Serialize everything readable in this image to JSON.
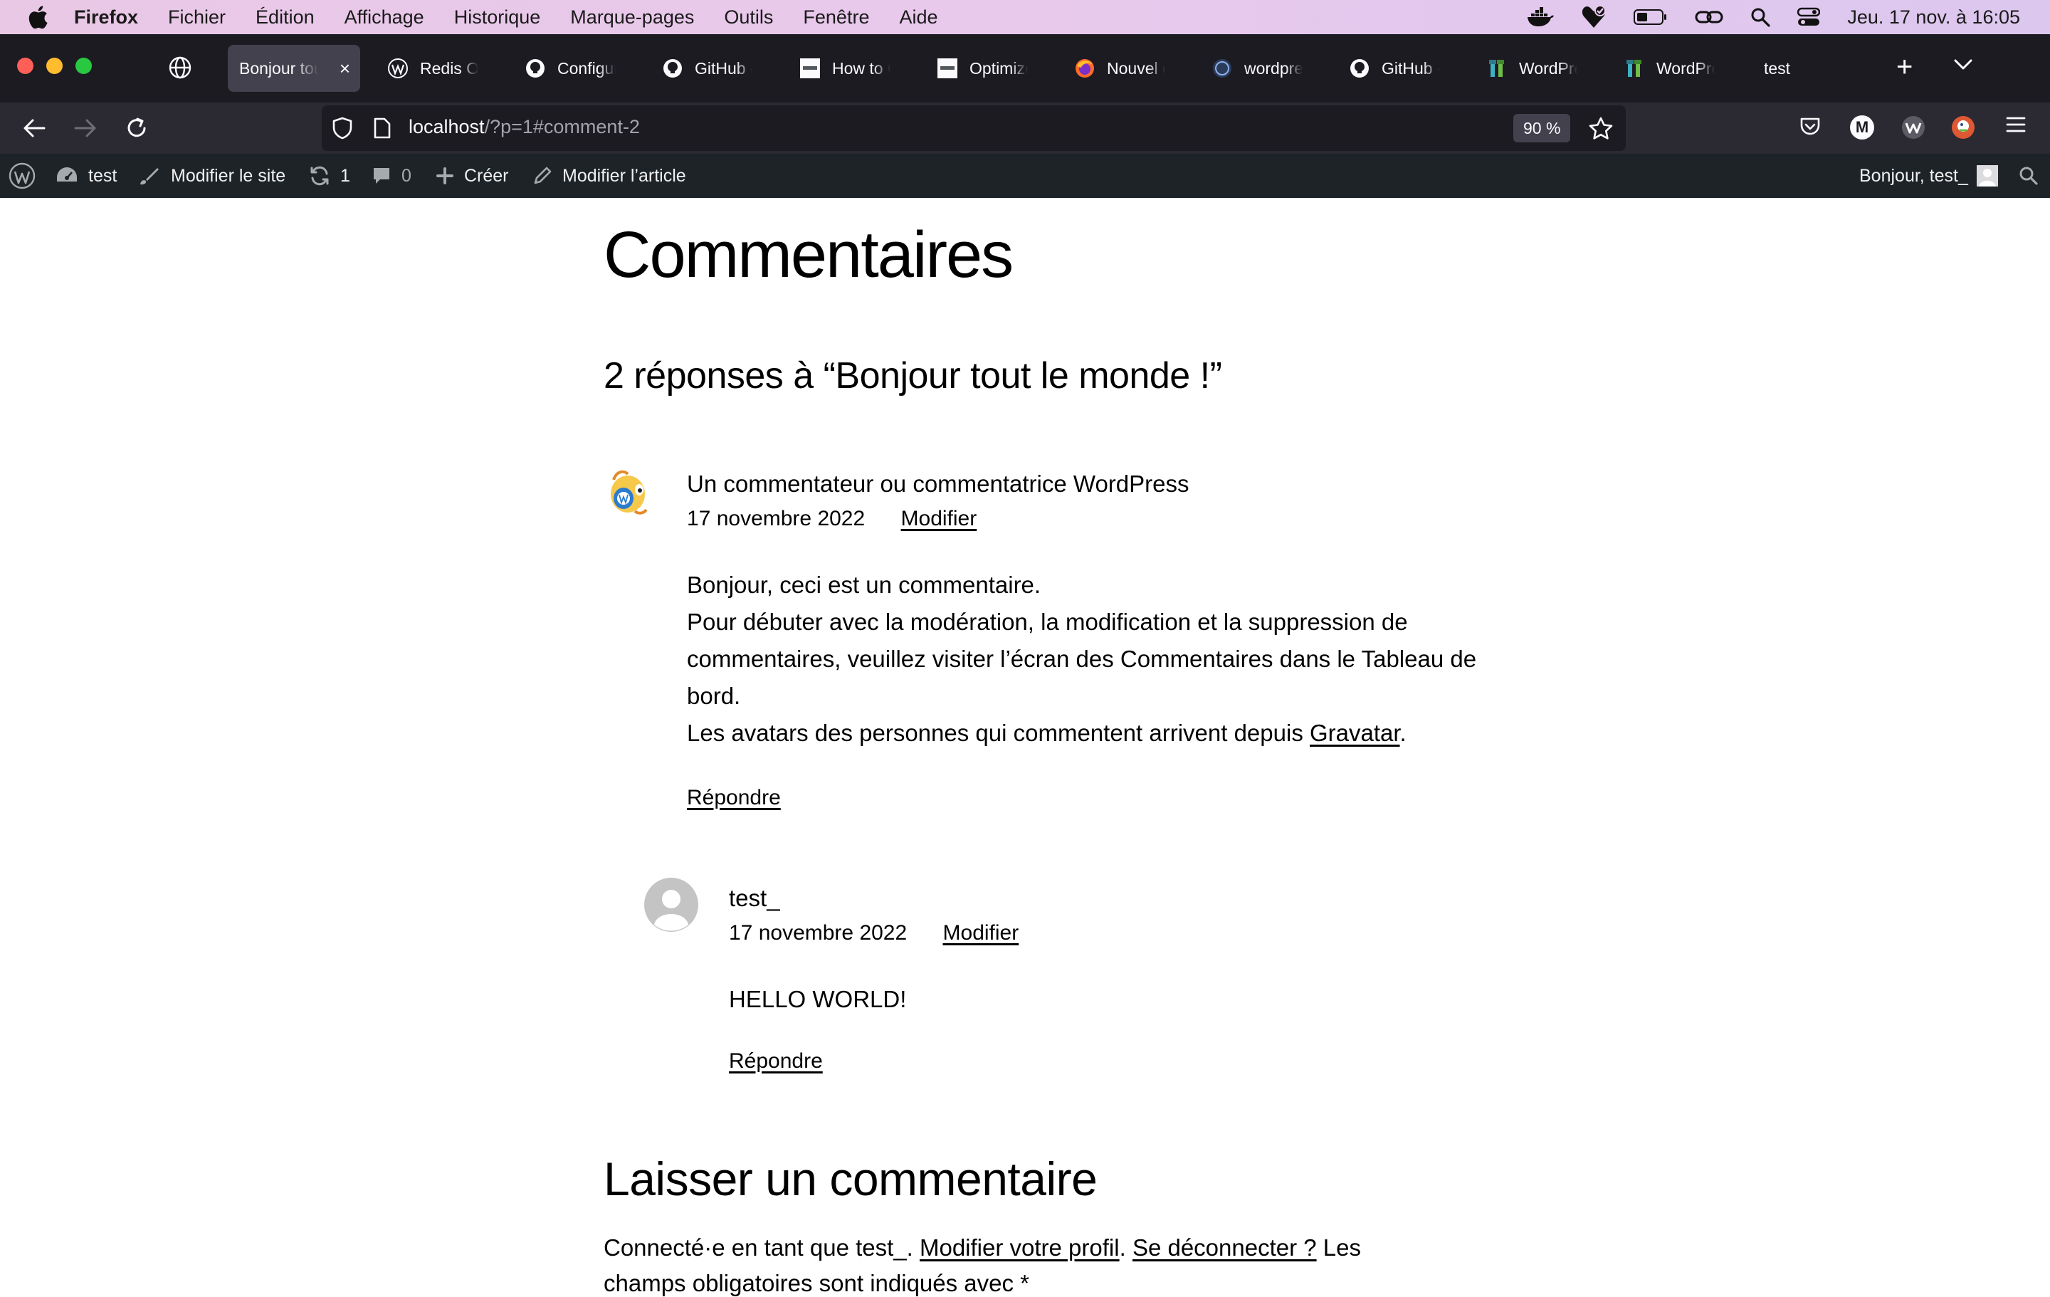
{
  "menubar": {
    "app": "Firefox",
    "items": [
      "Fichier",
      "Édition",
      "Affichage",
      "Historique",
      "Marque-pages",
      "Outils",
      "Fenêtre",
      "Aide"
    ],
    "clock": "Jeu. 17 nov. à  16:05"
  },
  "tabs": [
    {
      "label": "Bonjour tout",
      "icon": "globe-icon",
      "active": true
    },
    {
      "label": "Redis Obje",
      "icon": "wordpress-icon"
    },
    {
      "label": "Configurat",
      "icon": "github-icon"
    },
    {
      "label": "GitHub - p",
      "icon": "github-icon"
    },
    {
      "label": "How to Op",
      "icon": "plesk-icon"
    },
    {
      "label": "Optimize V",
      "icon": "plesk-icon"
    },
    {
      "label": "Nouvel ong",
      "icon": "firefox-icon"
    },
    {
      "label": "wordpress",
      "icon": "docker-icon"
    },
    {
      "label": "GitHub - d",
      "icon": "github-icon"
    },
    {
      "label": "WordPress",
      "icon": "wp-plugin-icon"
    },
    {
      "label": "WordPress",
      "icon": "wp-plugin-icon"
    },
    {
      "label": "test",
      "icon": "none"
    }
  ],
  "urlbar": {
    "host": "localhost",
    "path": "/?p=1#comment-2",
    "zoom": "90 %"
  },
  "adminbar": {
    "site": "test",
    "edit_site": "Modifier le site",
    "updates": "1",
    "comments": "0",
    "new": "Créer",
    "edit_post": "Modifier l’article",
    "greeting": "Bonjour, test_"
  },
  "page": {
    "title": "Commentaires",
    "responses_heading": "2 réponses à “Bonjour tout le monde !”",
    "comments": [
      {
        "author": "Un commentateur ou commentatrice WordPress",
        "date": "17 novembre 2022",
        "edit": "Modifier",
        "body_line1": "Bonjour, ceci est un commentaire.",
        "body_line2": "Pour débuter avec la modération, la modification et la suppression de commentaires, veuillez visiter l’écran des Commentaires dans le Tableau de bord.",
        "body_line3_pre": "Les avatars des personnes qui commentent arrivent depuis ",
        "body_line3_link": "Gravatar",
        "body_line3_post": ".",
        "reply": "Répondre"
      },
      {
        "author": "test_",
        "date": "17 novembre 2022",
        "edit": "Modifier",
        "body": "HELLO WORLD!",
        "reply": "Répondre"
      }
    ],
    "leave_heading": "Laisser un commentaire",
    "logged_pre": "Connecté·e en tant que test_. ",
    "profile_link": "Modifier votre profil",
    "logged_mid": ". ",
    "logout_link": "Se déconnecter ?",
    "logged_post": " Les",
    "logged_line2": "champs obligatoires sont indiqués avec *"
  },
  "colors": {
    "tabstrip": "#1c1b22",
    "toolbar": "#2b2a33",
    "adminbar": "#1d2327",
    "menubar": "#e9c8e6"
  }
}
